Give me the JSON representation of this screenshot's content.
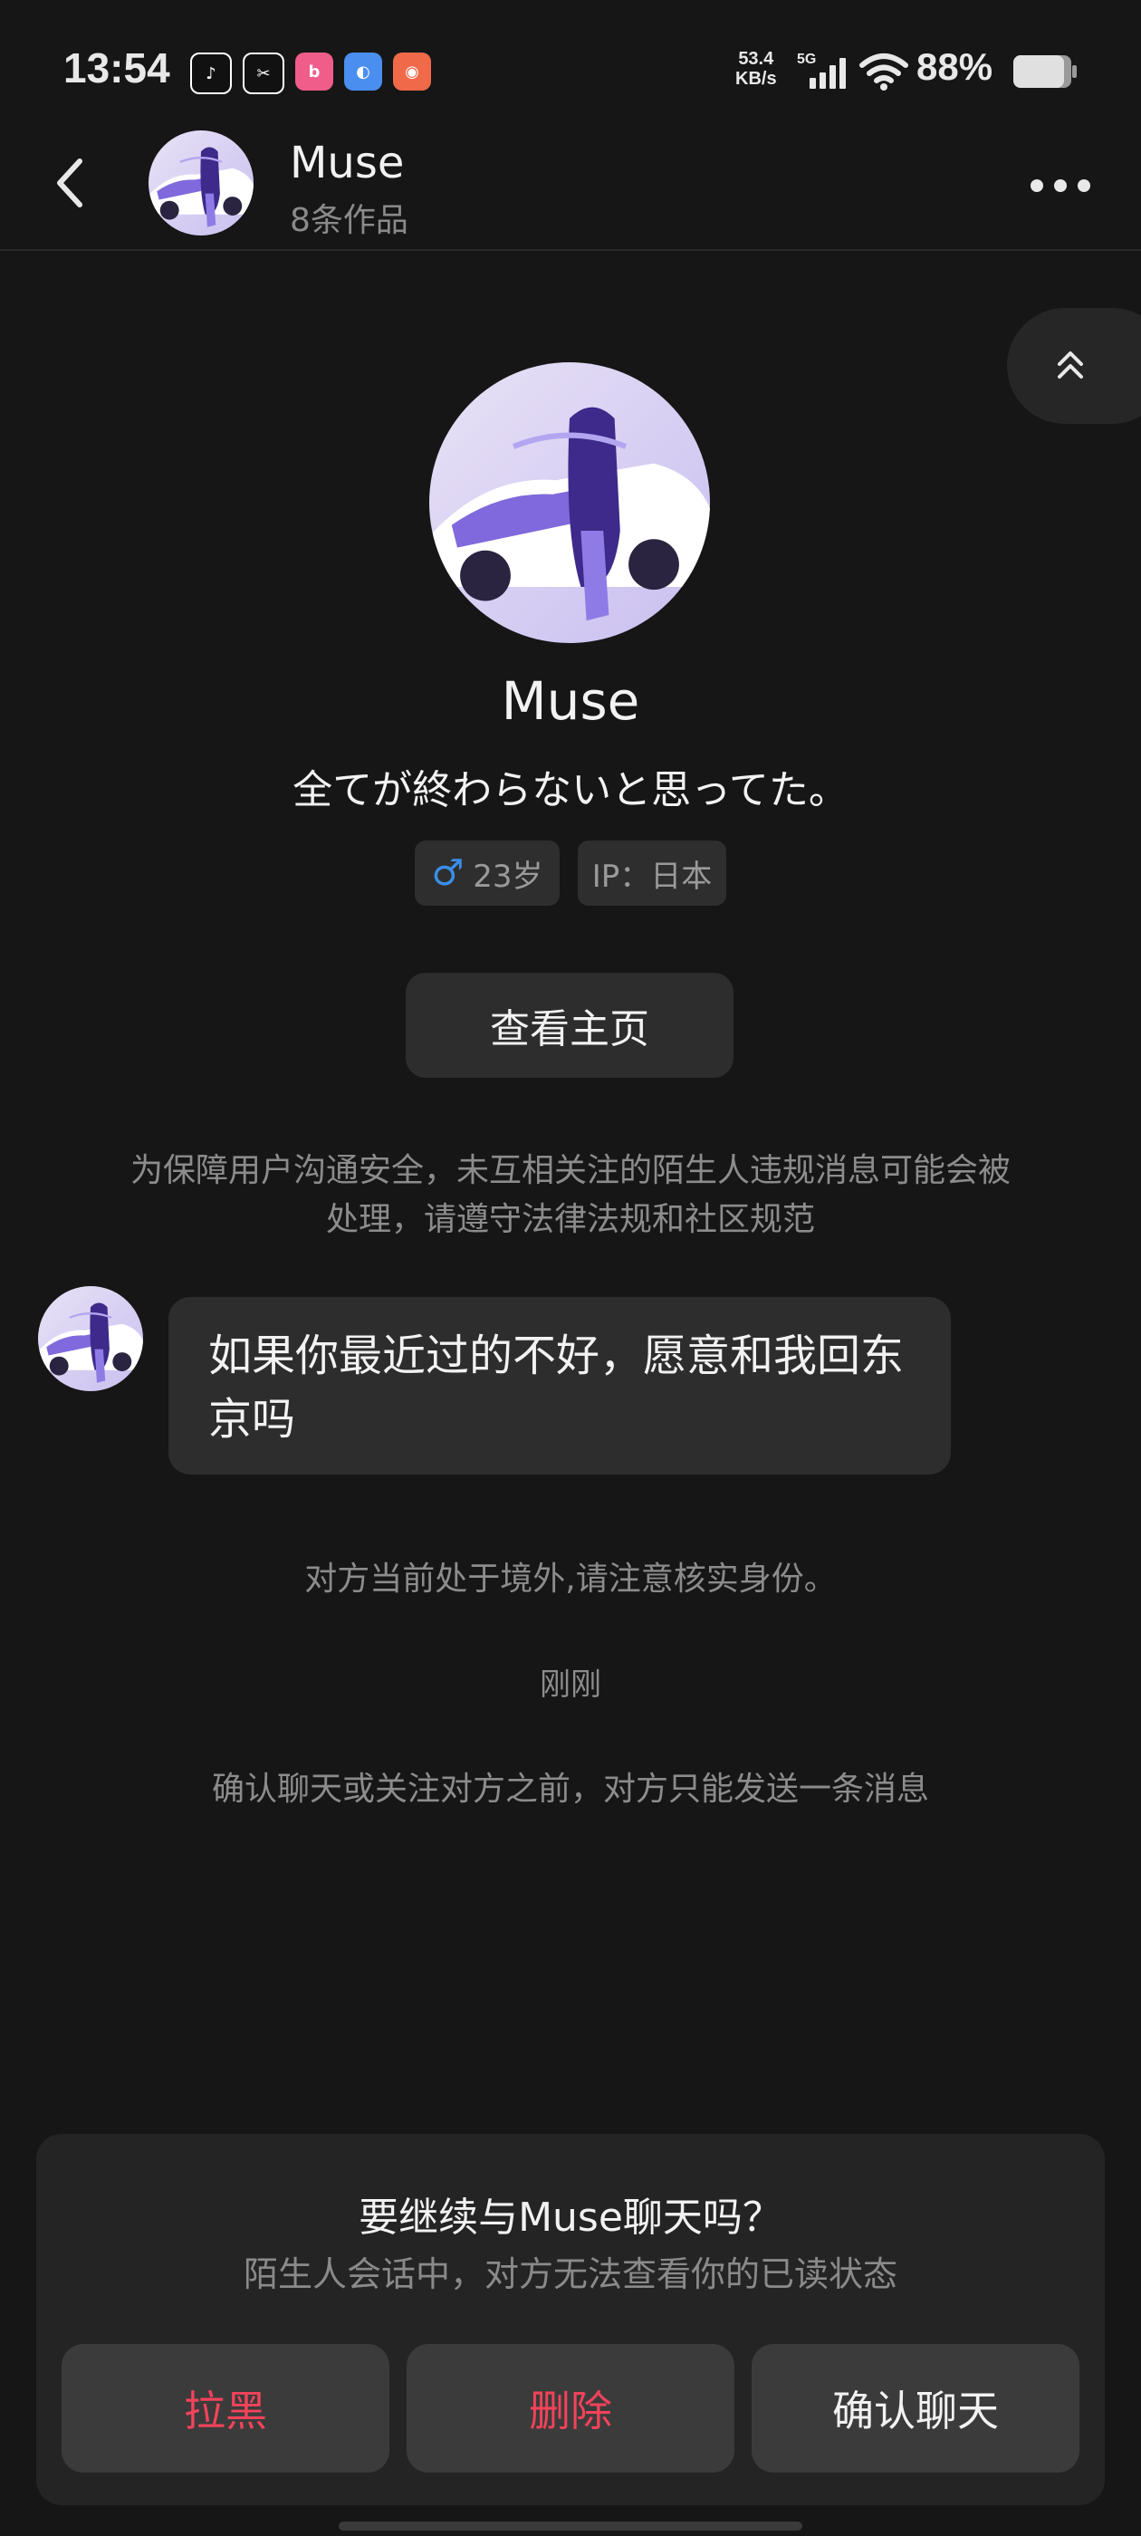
{
  "status_bar": {
    "time": "13:54",
    "apps": [
      "tiktok-icon",
      "capcut-icon",
      "bilibili-icon",
      "app-icon",
      "app-icon"
    ],
    "net_speed_value": "53.4",
    "net_speed_unit": "KB/s",
    "network": "5G",
    "battery_pct": "88%"
  },
  "header": {
    "name": "Muse",
    "subtitle": "8条作品"
  },
  "profile": {
    "name": "Muse",
    "bio": "全てが終わらないと思ってた。",
    "age_tag": "23岁",
    "ip_tag": "IP：日本",
    "view_home_label": "查看主页"
  },
  "chat": {
    "safety_notice": "为保障用户沟通安全，未互相关注的陌生人违规消息可能会被处理，请遵守法律法规和社区规范",
    "message": "如果你最近过的不好，愿意和我回东京吗",
    "overseas_notice": "对方当前处于境外,请注意核实身份。",
    "timestamp": "刚刚",
    "limit_notice": "确认聊天或关注对方之前，对方只能发送一条消息"
  },
  "panel": {
    "title": "要继续与Muse聊天吗？",
    "subtitle": "陌生人会话中，对方无法查看你的已读状态",
    "block_label": "拉黑",
    "delete_label": "删除",
    "confirm_label": "确认聊天"
  },
  "colors": {
    "background": "#161616",
    "danger": "#f2435a",
    "male": "#3a8ee6"
  }
}
